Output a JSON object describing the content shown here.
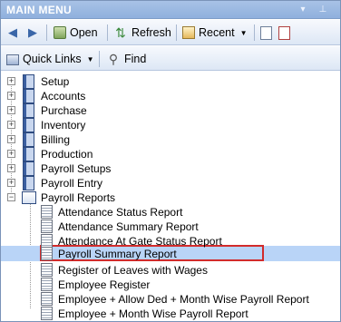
{
  "window": {
    "title": "MAIN MENU",
    "pin_glyph": "▾",
    "close_glyph": "⊥"
  },
  "toolbar": {
    "back_icon": "back-arrow-icon",
    "forward_icon": "forward-arrow-icon",
    "open_label": "Open",
    "refresh_label": "Refresh",
    "recent_label": "Recent",
    "recent_caret": "▼",
    "refresh_glyph": "⇅"
  },
  "toolbar2": {
    "quick_links_label": "Quick Links",
    "quick_caret": "▼",
    "find_label": "Find",
    "find_glyph": "⚲"
  },
  "tree": {
    "top_items": [
      {
        "label": "Setup",
        "expander": "+"
      },
      {
        "label": "Accounts",
        "expander": "+"
      },
      {
        "label": "Purchase",
        "expander": "+"
      },
      {
        "label": "Inventory",
        "expander": "+"
      },
      {
        "label": "Billing",
        "expander": "+"
      },
      {
        "label": "Production",
        "expander": "+"
      },
      {
        "label": "Payroll Setups",
        "expander": "+"
      },
      {
        "label": "Payroll Entry",
        "expander": "+"
      },
      {
        "label": "Payroll Reports",
        "expander": "−"
      }
    ],
    "reports": [
      {
        "label": "Attendance Status Report"
      },
      {
        "label": "Attendance Summary Report"
      },
      {
        "label": "Attendance At Gate Status Report"
      },
      {
        "label": "Payroll Summary Report",
        "selected": true
      },
      {
        "label": "Register of Leaves with Wages"
      },
      {
        "label": "Employee Register"
      },
      {
        "label": "Employee + Allow Ded + Month Wise Payroll Report"
      },
      {
        "label": "Employee + Month Wise Payroll Report"
      }
    ]
  },
  "colors": {
    "title_bar": "#9bb8e2",
    "selection": "#b9d4f7",
    "highlight_border": "#d22b2b"
  }
}
